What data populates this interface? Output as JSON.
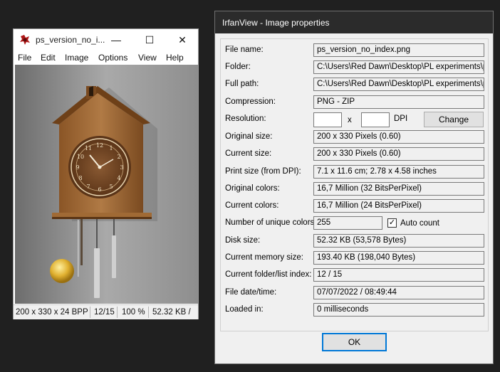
{
  "main_window": {
    "title": "ps_version_no_i...",
    "controls": {
      "minimize": "—",
      "maximize": "☐",
      "close": "✕"
    },
    "menu": [
      "File",
      "Edit",
      "Image",
      "Options",
      "View",
      "Help"
    ],
    "status": {
      "dimensions": "200 x 330 x 24 BPP",
      "index": "12/15",
      "zoom": "100 %",
      "size": "52.32 KB /"
    }
  },
  "dialog": {
    "title": "IrfanView - Image properties",
    "fields": {
      "file_name": {
        "label": "File name:",
        "value": "ps_version_no_index.png"
      },
      "folder": {
        "label": "Folder:",
        "value": "C:\\Users\\Red Dawn\\Desktop\\PL experiments\\pr"
      },
      "full_path": {
        "label": "Full path:",
        "value": "C:\\Users\\Red Dawn\\Desktop\\PL experiments\\pr"
      },
      "compression": {
        "label": "Compression:",
        "value": "PNG - ZIP"
      },
      "resolution": {
        "label": "Resolution:",
        "x_value": "",
        "y_value": "",
        "separator": "x",
        "unit": "DPI",
        "button": "Change"
      },
      "original_size": {
        "label": "Original size:",
        "value": "200 x 330  Pixels (0.60)"
      },
      "current_size": {
        "label": "Current size:",
        "value": "200 x 330  Pixels (0.60)"
      },
      "print_size": {
        "label": "Print size (from DPI):",
        "value": "7.1 x 11.6 cm; 2.78 x 4.58 inches"
      },
      "original_colors": {
        "label": "Original colors:",
        "value": "16,7 Million  (32 BitsPerPixel)"
      },
      "current_colors": {
        "label": "Current colors:",
        "value": "16,7 Million  (24 BitsPerPixel)"
      },
      "unique_colors": {
        "label": "Number of unique colors:",
        "value": "255",
        "checkbox_label": "Auto count",
        "checkbox_checked": true
      },
      "disk_size": {
        "label": "Disk size:",
        "value": "52.32 KB (53,578 Bytes)"
      },
      "memory_size": {
        "label": "Current memory size:",
        "value": "193.40  KB (198,040 Bytes)"
      },
      "folder_index": {
        "label": "Current folder/list index:",
        "value": "12  /  15"
      },
      "file_date": {
        "label": "File date/time:",
        "value": "07/07/2022 / 08:49:44"
      },
      "loaded_in": {
        "label": "Loaded in:",
        "value": "0 milliseconds"
      }
    },
    "ok_button": "OK"
  }
}
